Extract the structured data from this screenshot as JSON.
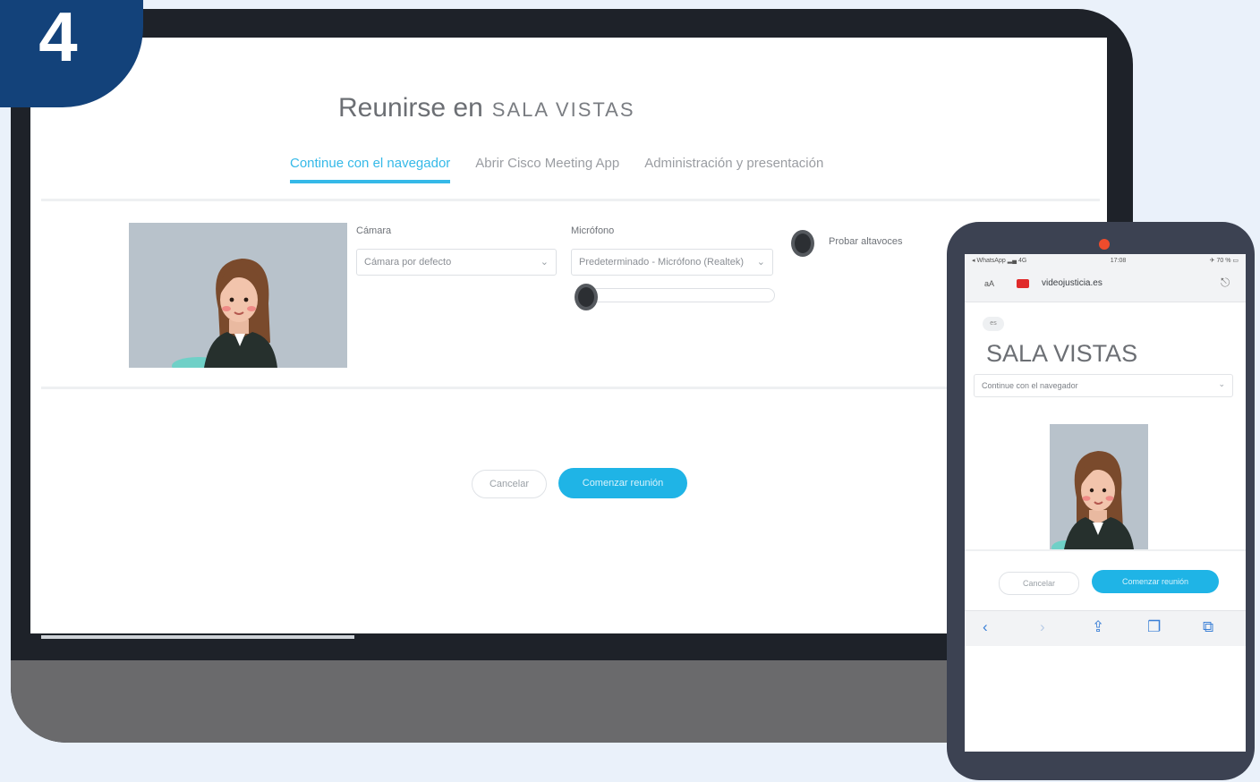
{
  "step": {
    "number": "4"
  },
  "desktop": {
    "title_prefix": "Reunirse en",
    "room_name": "SALA VISTAS",
    "tabs": [
      {
        "label": "Continue con el navegador",
        "active": true
      },
      {
        "label": "Abrir Cisco Meeting App",
        "active": false
      },
      {
        "label": "Administración y presentación",
        "active": false
      }
    ],
    "camera": {
      "label": "Cámara",
      "value": "Cámara por defecto"
    },
    "microphone": {
      "label": "Micrófono",
      "value": "Predeterminado - Micrófono (Realtek)"
    },
    "speaker": {
      "label": "Probar altavoces"
    },
    "buttons": {
      "cancel": "Cancelar",
      "start": "Comenzar reunión"
    }
  },
  "phone": {
    "status_bar": {
      "carrier": "◂ WhatsApp ▂▄ 4G",
      "time": "17:08",
      "battery": "✈ 70 % ▭"
    },
    "url": {
      "aa": "aA",
      "text": "videojusticia.es"
    },
    "lang": "es",
    "room_name": "SALA VISTAS",
    "join_option": "Continue con el navegador",
    "buttons": {
      "cancel": "Cancelar",
      "start": "Comenzar reunión"
    }
  },
  "colors": {
    "accent": "#1fb4e6",
    "badge": "#13427a",
    "phone_frame": "#3c4252"
  },
  "icons": [
    "select-chevron-icon",
    "mic-icon",
    "speaker-icon",
    "camera-icon",
    "share-icon",
    "back-icon",
    "forward-icon",
    "bookmarks-icon",
    "tabs-icon"
  ]
}
